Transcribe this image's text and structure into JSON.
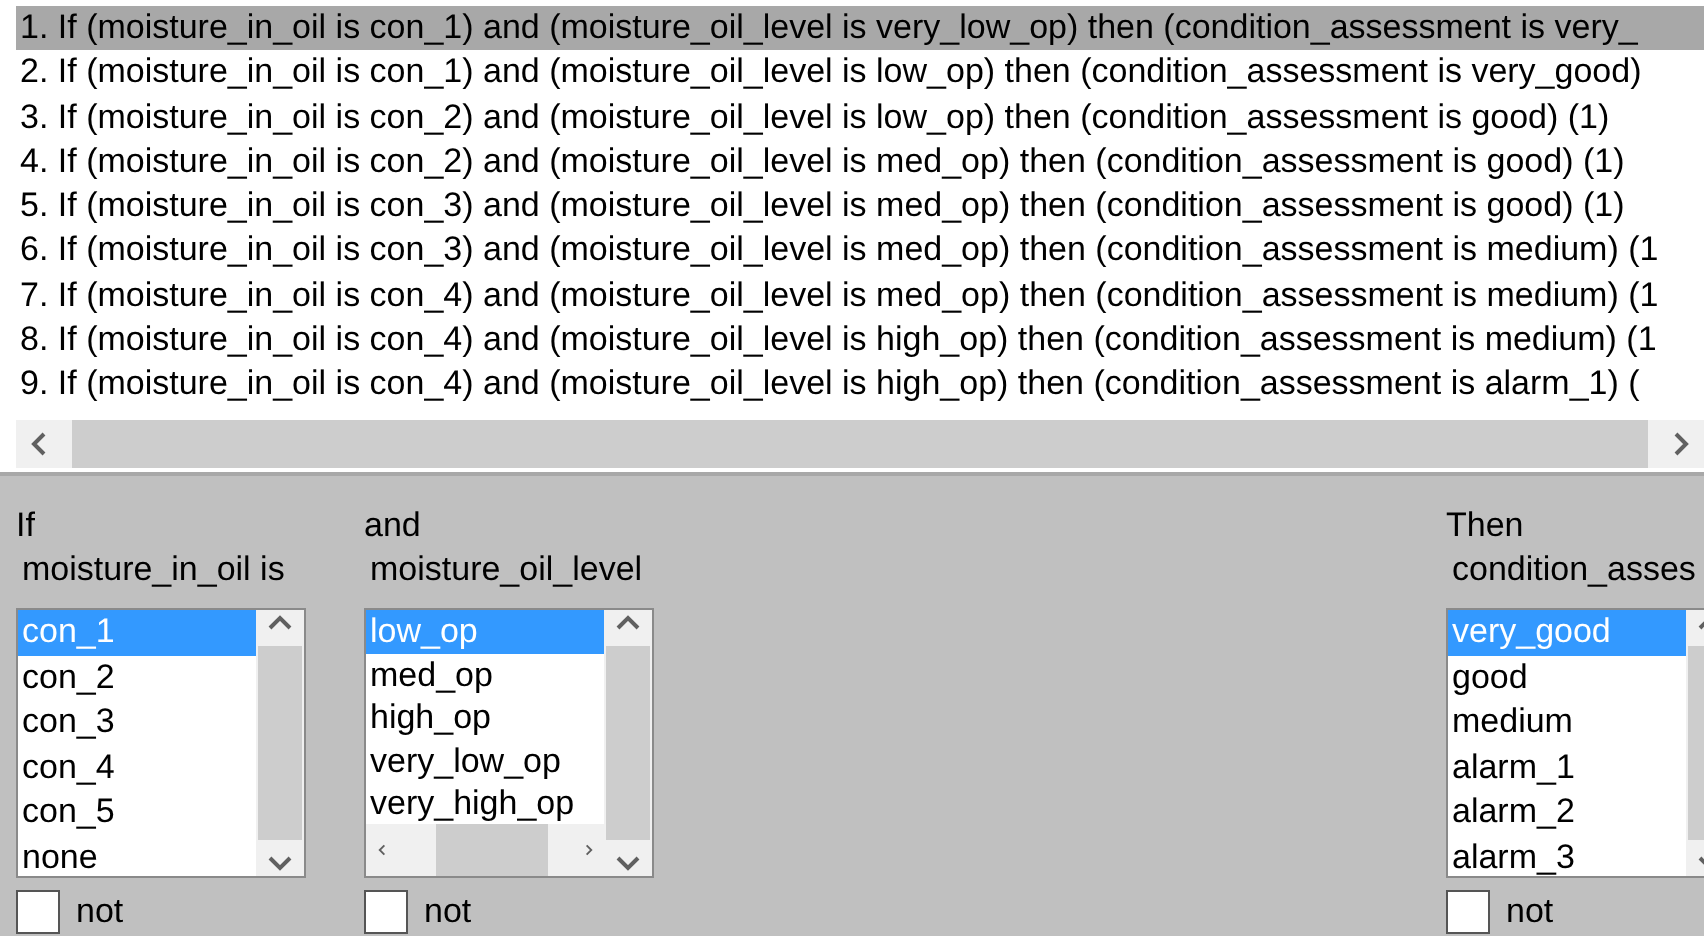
{
  "rules": [
    {
      "text": "1. If (moisture_in_oil is con_1) and (moisture_oil_level is very_low_op) then (condition_assessment is very_",
      "selected": true
    },
    {
      "text": "2. If (moisture_in_oil is con_1) and (moisture_oil_level is low_op) then (condition_assessment is very_good)",
      "selected": false
    },
    {
      "text": "3. If (moisture_in_oil is con_2) and (moisture_oil_level is low_op) then (condition_assessment is good) (1)",
      "selected": false
    },
    {
      "text": "4. If (moisture_in_oil is con_2) and (moisture_oil_level is med_op) then (condition_assessment is good) (1)",
      "selected": false
    },
    {
      "text": "5. If (moisture_in_oil is con_3) and (moisture_oil_level is med_op) then (condition_assessment is good) (1)",
      "selected": false
    },
    {
      "text": "6. If (moisture_in_oil is con_3) and (moisture_oil_level is med_op) then (condition_assessment is medium) (1",
      "selected": false
    },
    {
      "text": "7. If (moisture_in_oil is con_4) and (moisture_oil_level is med_op) then (condition_assessment is medium) (1",
      "selected": false
    },
    {
      "text": "8. If (moisture_in_oil is con_4) and (moisture_oil_level is high_op) then (condition_assessment is medium) (1",
      "selected": false
    },
    {
      "text": "9. If (moisture_in_oil is con_4) and (moisture_oil_level is high_op) then (condition_assessment is alarm_1) (",
      "selected": false
    }
  ],
  "columns": [
    {
      "kind": "if",
      "connective": "If",
      "variable": "moisture_in_oil is",
      "h_scroll": false,
      "items": [
        {
          "label": "con_1",
          "selected": true
        },
        {
          "label": "con_2",
          "selected": false
        },
        {
          "label": "con_3",
          "selected": false
        },
        {
          "label": "con_4",
          "selected": false
        },
        {
          "label": "con_5",
          "selected": false
        },
        {
          "label": "none",
          "selected": false
        }
      ],
      "not": {
        "label": "not",
        "checked": false
      }
    },
    {
      "kind": "and",
      "connective": "and",
      "variable": "moisture_oil_level",
      "h_scroll": true,
      "items": [
        {
          "label": "low_op",
          "selected": true
        },
        {
          "label": "med_op",
          "selected": false
        },
        {
          "label": "high_op",
          "selected": false
        },
        {
          "label": "very_low_op",
          "selected": false
        },
        {
          "label": "very_high_op",
          "selected": false
        }
      ],
      "not": {
        "label": "not",
        "checked": false
      }
    },
    {
      "kind": "then",
      "connective": "Then",
      "variable": "condition_asses",
      "h_scroll": false,
      "items": [
        {
          "label": "very_good",
          "selected": true
        },
        {
          "label": "good",
          "selected": false
        },
        {
          "label": "medium",
          "selected": false
        },
        {
          "label": "alarm_1",
          "selected": false
        },
        {
          "label": "alarm_2",
          "selected": false
        },
        {
          "label": "alarm_3",
          "selected": false
        }
      ],
      "not": {
        "label": "not",
        "checked": false
      }
    }
  ]
}
